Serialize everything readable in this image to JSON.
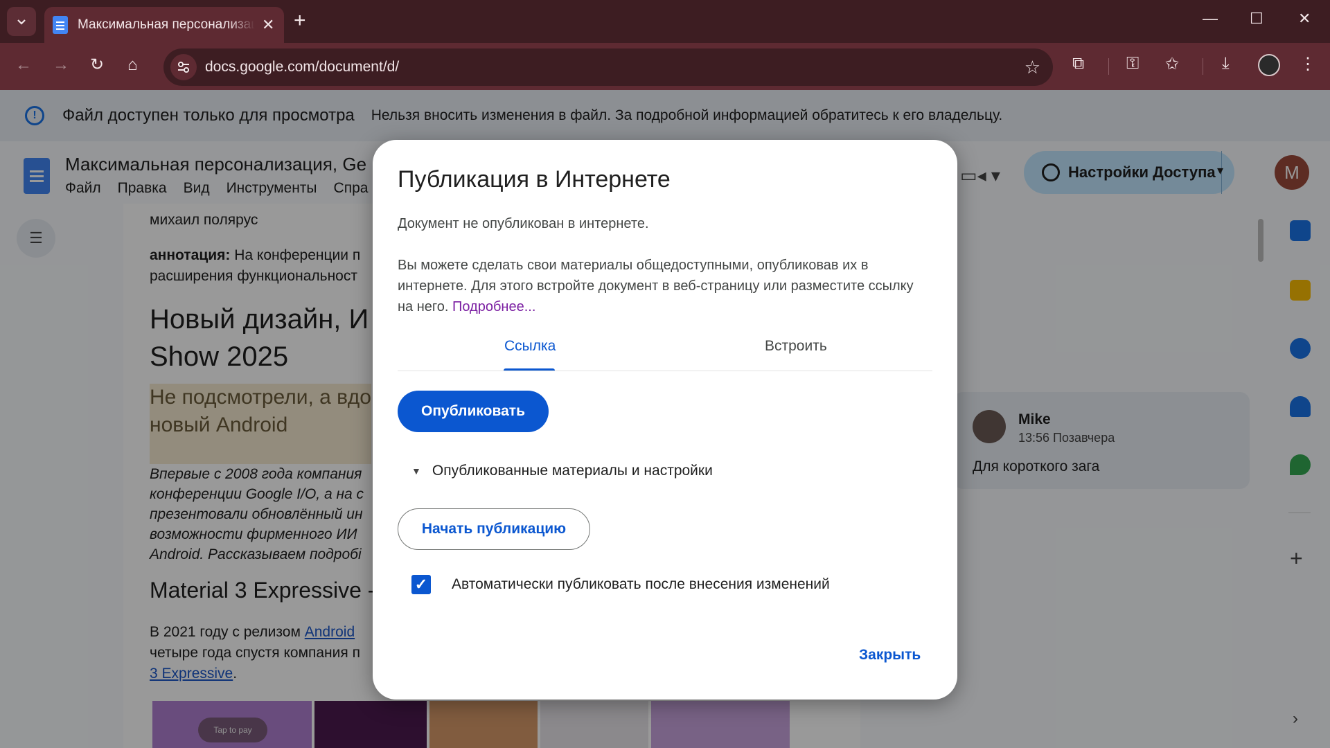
{
  "browser": {
    "tab_title": "Максимальная персонализация, Gemini",
    "tab_close": "✕",
    "new_tab": "+",
    "window_controls": {
      "minimize": "—",
      "maximize": "☐",
      "close": "✕"
    },
    "url": "docs.google.com/document/d/",
    "icons": [
      "tab-search-icon",
      "back-arrow-icon",
      "forward-arrow-icon",
      "reload-icon",
      "home-icon",
      "site-settings-icon",
      "bookmark-star-icon",
      "extensions-icon",
      "password-key-icon",
      "bookmarks-icon",
      "download-icon",
      "menu-dots-icon"
    ]
  },
  "banner": {
    "title": "Файл доступен только для просмотра",
    "text": "Нельзя вносить изменения в файл. За подробной информацией обратитесь к его владельцу."
  },
  "docs": {
    "title": "Максимальная персонализация, Ge",
    "menus": [
      "Файл",
      "Правка",
      "Вид",
      "Инструменты",
      "Спра"
    ],
    "share_label": "Настройки Доступа",
    "avatar_letter": "M",
    "content": {
      "author": "михаил полярус",
      "abstract_label": "аннотация:",
      "abstract_line1": " На конференции п",
      "abstract_line2": "расширения функциональност",
      "heading_line1": "Новый дизайн, И",
      "heading_line2": "Show 2025",
      "highlight_line1": "Не подсмотрели, а вдо",
      "highlight_line2": "новый Android",
      "italic_lines": [
        "Впервые с 2008 года компания",
        "конференции Google I/O, а на с",
        "презентовали обновлённый ин",
        "возможности фирменного ИИ",
        "Android. Рассказываем подробі"
      ],
      "h2": "Material 3 Expressive -",
      "body_prefix": "В 2021 году с релизом ",
      "body_link": "Android",
      "body_line2": "четыре года спустя компания п",
      "body_link2": "3 Expressive",
      "body_suffix": ".",
      "thumb_text": "Tap to pay"
    },
    "comment": {
      "author": "Mike",
      "time": "13:56 Позавчера",
      "text": "Для короткого зага"
    }
  },
  "dialog": {
    "title": "Публикация в Интернете",
    "status": "Документ не опубликован в интернете.",
    "description": "Вы можете сделать свои материалы общедоступными, опубликовав их в интернете. Для этого встройте документ в веб-страницу или разместите ссылку на него.",
    "more_link": "Подробнее...",
    "tabs": [
      "Ссылка",
      "Встроить"
    ],
    "active_tab": "Ссылка",
    "publish_button": "Опубликовать",
    "expander_label": "Опубликованные материалы и настройки",
    "start_button": "Начать публикацию",
    "auto_publish_label": "Автоматически публиковать после внесения изменений",
    "auto_publish_checked": true,
    "close_button": "Закрыть"
  },
  "colors": {
    "browser_frame": "#3d1d22",
    "browser_toolbar": "#5e2a32",
    "accent_blue": "#0b57d0",
    "link_purple": "#7b1fa2",
    "share_button_bg": "#c2e7ff"
  }
}
